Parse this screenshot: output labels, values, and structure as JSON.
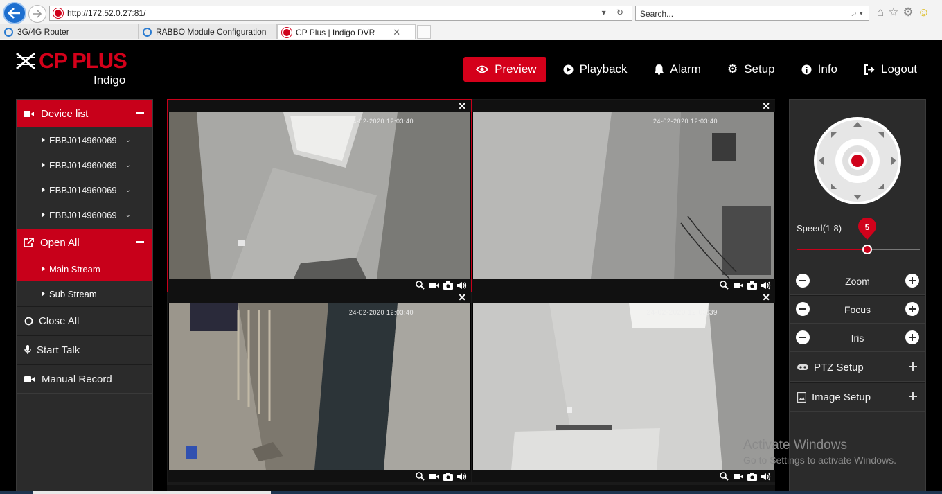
{
  "browser": {
    "url": "http://172.52.0.27:81/",
    "search_placeholder": "Search...",
    "tabs": [
      {
        "label": "3G/4G Router"
      },
      {
        "label": "RABBO Module Configuration"
      },
      {
        "label": "CP Plus | Indigo DVR",
        "active": true
      }
    ]
  },
  "header": {
    "brand": "CP PLUS",
    "sub": "Indigo",
    "brand_color": "#d4001a",
    "nav": [
      {
        "label": "Preview",
        "icon": "eye-icon",
        "active": true
      },
      {
        "label": "Playback",
        "icon": "play-circle-icon"
      },
      {
        "label": "Alarm",
        "icon": "bell-icon"
      },
      {
        "label": "Setup",
        "icon": "gear-icon"
      },
      {
        "label": "Info",
        "icon": "info-icon"
      },
      {
        "label": "Logout",
        "icon": "logout-icon"
      }
    ]
  },
  "sidebar": {
    "device_list_label": "Device list",
    "devices": [
      "EBBJ014960069",
      "EBBJ014960069",
      "EBBJ014960069",
      "EBBJ014960069"
    ],
    "open_all_label": "Open All",
    "streams": [
      {
        "label": "Main Stream",
        "active": true
      },
      {
        "label": "Sub Stream"
      }
    ],
    "close_all_label": "Close All",
    "start_talk_label": "Start Talk",
    "manual_record_label": "Manual Record"
  },
  "cameras": [
    {
      "timestamp": "24-02-2020 12:03:40"
    },
    {
      "timestamp": "24-02-2020 12:03:40"
    },
    {
      "timestamp": "24-02-2020 12:03:40"
    },
    {
      "timestamp": "24-02-2020 12:03:39"
    }
  ],
  "ptz": {
    "speed_label": "Speed(1-8)",
    "speed_value": "5",
    "speed_min": 1,
    "speed_max": 8,
    "zoom_label": "Zoom",
    "focus_label": "Focus",
    "iris_label": "Iris",
    "ptz_setup_label": "PTZ Setup",
    "image_setup_label": "Image Setup"
  },
  "watermark": {
    "line1": "Activate Windows",
    "line2": "Go to Settings to activate Windows."
  }
}
